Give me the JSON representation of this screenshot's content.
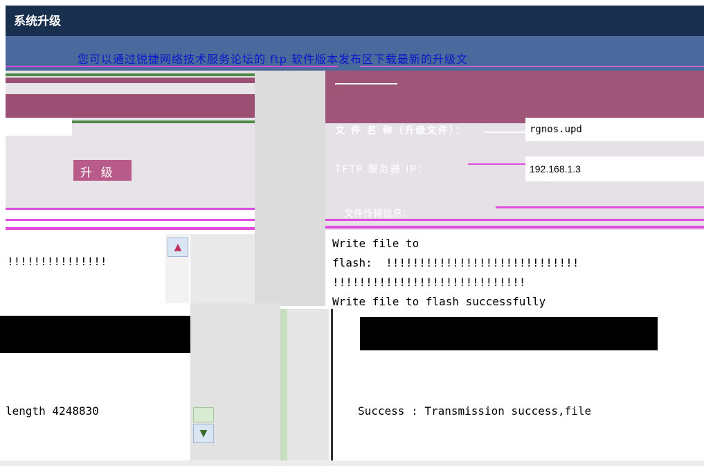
{
  "window": {
    "title": "系统升级"
  },
  "notice": {
    "text": "您可以通过锐捷网络技术服务论坛的 ftp 软件版本发布区下载最新的升级文"
  },
  "upgrade": {
    "button_label": "升 级"
  },
  "form": {
    "file_label": "文 件 名 称（升级文件）：",
    "file_value": "rgnos.upd",
    "tftp_label": "TFTP 服务器 IP：",
    "tftp_value": "192.168.1.3",
    "transfer_info_label": "文件传输信息："
  },
  "log_left": {
    "line1": "!!!!!!!!!!!!!!!",
    "line2": "length 4248830"
  },
  "log_right": {
    "text": "Write file to\nflash:  !!!!!!!!!!!!!!!!!!!!!!!!!!!!!\n!!!!!!!!!!!!!!!!!!!!!!!!!!!!!\nWrite file to flash successfully",
    "success": "Success : Transmission success,file"
  },
  "icons": {
    "scroll_up": "chevron-up-icon",
    "scroll_down": "chevron-down-icon"
  },
  "colors": {
    "title_bg": "#18304e",
    "notice_bg": "#4a6a9d",
    "magenta_band": "#9a4f73",
    "pink_line": "#e04ae0",
    "button_bg": "#b85a8a"
  }
}
